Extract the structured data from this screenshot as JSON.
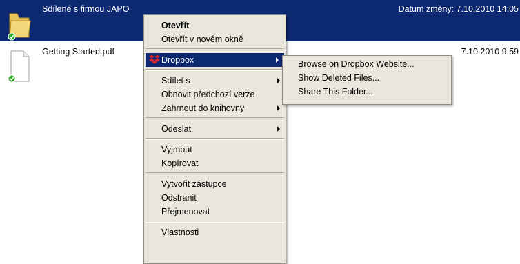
{
  "files": [
    {
      "name": "Sdílené s firmou JAPO",
      "date": "Datum změny: 7.10.2010 14:05",
      "icon": "folder-icon",
      "selected": true
    },
    {
      "name": "Getting Started.pdf",
      "date": "7.10.2010 9:59",
      "icon": "pdf-document-icon",
      "selected": false
    }
  ],
  "context_menu": {
    "open": "Otevřít",
    "open_new_window": "Otevřít v novém okně",
    "dropbox": "Dropbox",
    "share_with": "Sdílet s",
    "restore_previous": "Obnovit předchozí verze",
    "include_library": "Zahrnout do knihovny",
    "send_to": "Odeslat",
    "cut": "Vyjmout",
    "copy": "Kopírovat",
    "create_shortcut": "Vytvořit zástupce",
    "delete": "Odstranit",
    "rename": "Přejmenovat",
    "properties": "Vlastnosti"
  },
  "dropbox_submenu": {
    "browse": "Browse on Dropbox Website...",
    "show_deleted": "Show Deleted Files...",
    "share_folder": "Share This Folder..."
  },
  "colors": {
    "selection": "#0b2870",
    "menu_bg": "#e9e6dc",
    "sync_badge": "#2fa829",
    "dropbox_brand": "#d9262c"
  }
}
